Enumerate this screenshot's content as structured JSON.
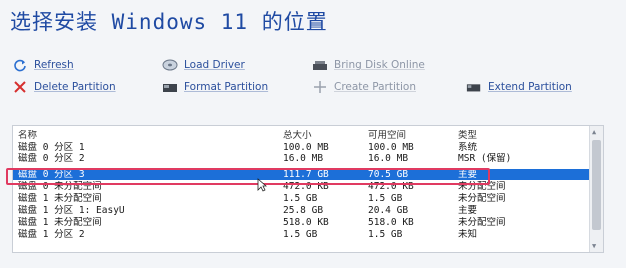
{
  "title": "选择安装 Windows 11 的位置",
  "actions": {
    "refresh": "Refresh",
    "load_driver": "Load Driver",
    "bring_disk_online": "Bring Disk Online",
    "delete_partition": "Delete Partition",
    "format_partition": "Format Partition",
    "create_partition": "Create Partition",
    "extend_partition": "Extend Partition"
  },
  "table": {
    "headers": [
      "名称",
      "总大小",
      "可用空间",
      "类型"
    ],
    "rows": [
      {
        "name": "磁盘 0 分区 1",
        "total": "100.0 MB",
        "free": "100.0 MB",
        "type": "系统"
      },
      {
        "name": "磁盘 0 分区 2",
        "total": "16.0 MB",
        "free": "16.0 MB",
        "type": "MSR (保留)"
      },
      {
        "name": "磁盘 0 分区 3",
        "total": "111.7 GB",
        "free": "70.5 GB",
        "type": "主要"
      },
      {
        "name": "磁盘 0 未分配空间",
        "total": "472.0 KB",
        "free": "472.0 KB",
        "type": "未分配空间"
      },
      {
        "name": "磁盘 1 未分配空间",
        "total": "1.5 GB",
        "free": "1.5 GB",
        "type": "未分配空间"
      },
      {
        "name": "磁盘 1 分区 1: EasyU",
        "total": "25.8 GB",
        "free": "20.4 GB",
        "type": "主要"
      },
      {
        "name": "磁盘 1 未分配空间",
        "total": "518.0 KB",
        "free": "518.0 KB",
        "type": "未分配空间"
      },
      {
        "name": "磁盘 1 分区 2",
        "total": "1.5 GB",
        "free": "1.5 GB",
        "type": "未知"
      }
    ]
  },
  "colors": {
    "title": "#1f4aa3",
    "link": "#2b4f9c",
    "selection": "#1c6fd8",
    "annotation_box": "#e03a61"
  }
}
